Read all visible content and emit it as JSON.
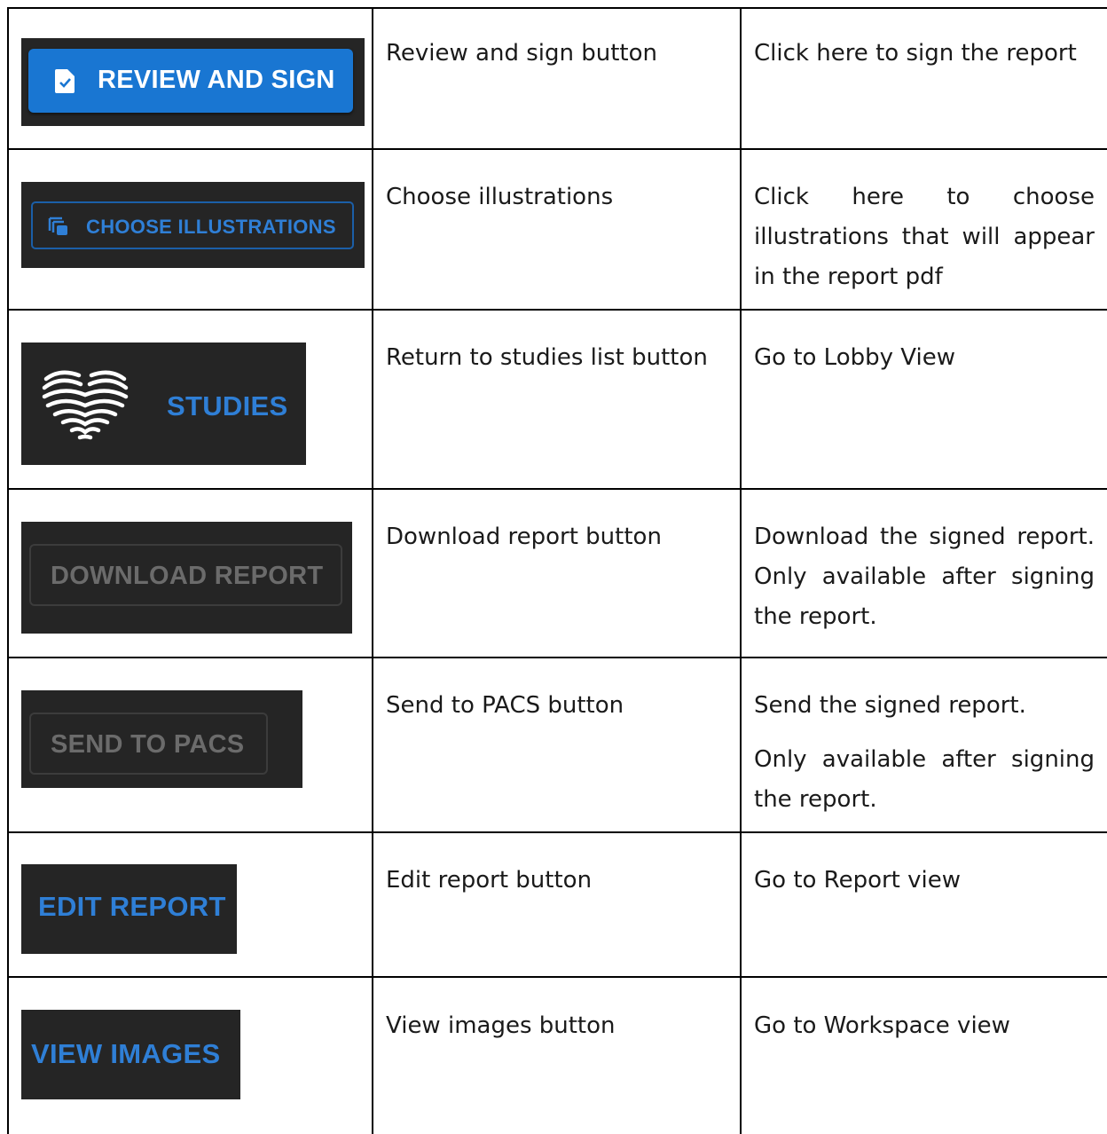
{
  "rows": [
    {
      "image_label": "REVIEW AND SIGN",
      "name": "Review and sign button",
      "desc": [
        "Click here to sign the report"
      ]
    },
    {
      "image_label": "CHOOSE ILLUSTRATIONS",
      "name": "Choose illustrations",
      "desc": [
        "Click here to choose illustrations that will appear in the report pdf"
      ]
    },
    {
      "image_label": "STUDIES",
      "name": "Return to studies list button",
      "desc": [
        "Go to Lobby View"
      ]
    },
    {
      "image_label": "DOWNLOAD REPORT",
      "name": "Download report button",
      "desc": [
        "Download the signed report. Only available after signing the report."
      ]
    },
    {
      "image_label": "SEND TO PACS",
      "name": "Send to PACS button",
      "desc": [
        "Send the signed report.",
        "Only available after signing the report."
      ]
    },
    {
      "image_label": "EDIT REPORT",
      "name": "Edit report button",
      "desc": [
        "Go to Report view"
      ]
    },
    {
      "image_label": "VIEW IMAGES",
      "name": "View images button",
      "desc": [
        "Go to Workspace view"
      ]
    }
  ],
  "colors": {
    "dark_bg": "#252525",
    "accent_blue": "#1976d2",
    "label_blue": "#2f7fd6",
    "disabled_gray": "#6b6b6b"
  }
}
